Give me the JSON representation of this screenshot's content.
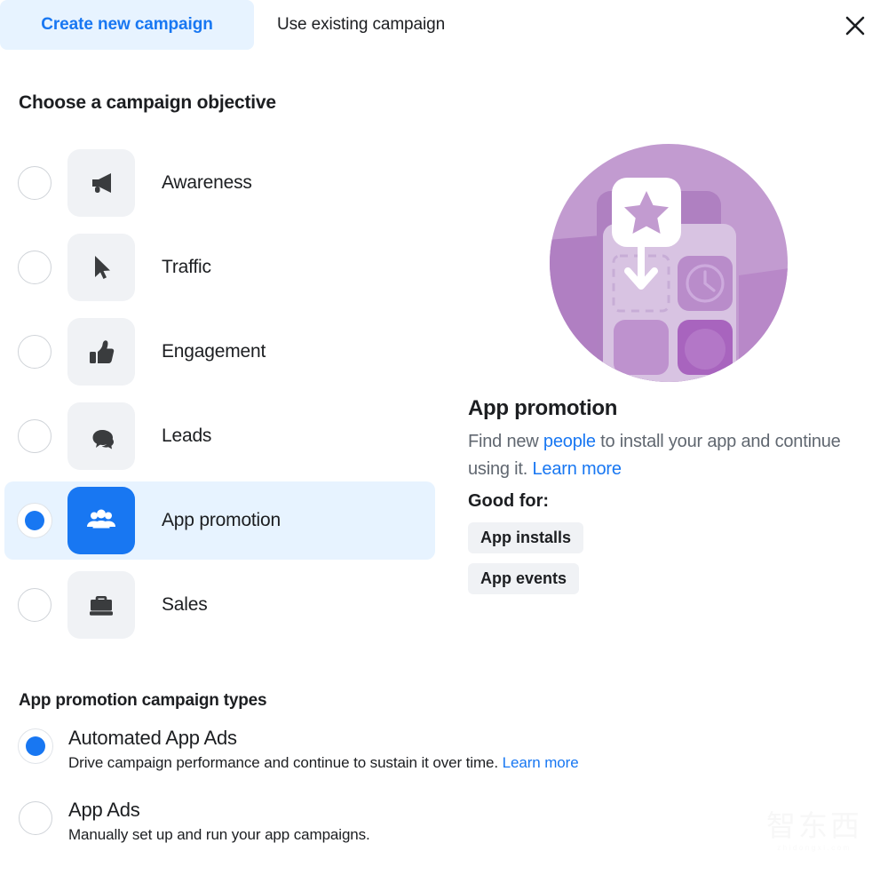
{
  "tabs": [
    {
      "label": "Create new campaign",
      "active": true
    },
    {
      "label": "Use existing campaign",
      "active": false
    }
  ],
  "close_icon": "close-icon",
  "objective_section": {
    "title": "Choose a campaign objective",
    "options": [
      {
        "label": "Awareness",
        "icon": "megaphone-icon",
        "selected": false
      },
      {
        "label": "Traffic",
        "icon": "cursor-icon",
        "selected": false
      },
      {
        "label": "Engagement",
        "icon": "thumbs-up-icon",
        "selected": false
      },
      {
        "label": "Leads",
        "icon": "speech-bubbles-icon",
        "selected": false
      },
      {
        "label": "App promotion",
        "icon": "people-group-icon",
        "selected": true
      },
      {
        "label": "Sales",
        "icon": "briefcase-icon",
        "selected": false
      }
    ]
  },
  "detail_panel": {
    "illustration": "app-promotion-illustration",
    "title": "App promotion",
    "description_part1": "Find new ",
    "description_link1": "people",
    "description_part2": " to install your app and continue using it. ",
    "description_link2": "Learn more",
    "good_for_label": "Good for:",
    "good_for_items": [
      "App installs",
      "App events"
    ]
  },
  "campaign_types": {
    "title": "App promotion campaign types",
    "options": [
      {
        "name": "Automated App Ads",
        "description": "Drive campaign performance and continue to sustain it over time. ",
        "link": "Learn more",
        "selected": true
      },
      {
        "name": "App Ads",
        "description": "Manually set up and run your app campaigns.",
        "link": "",
        "selected": false
      }
    ]
  },
  "watermark": {
    "main": "智东西",
    "sub": "zhidongxi.com"
  },
  "colors": {
    "accent_blue": "#1877F2",
    "selected_row_bg": "#E7F3FF",
    "tile_bg": "#F0F2F5",
    "text_primary": "#1c1e21",
    "text_secondary": "#606770",
    "illustration_purple": "#B68BC4"
  }
}
